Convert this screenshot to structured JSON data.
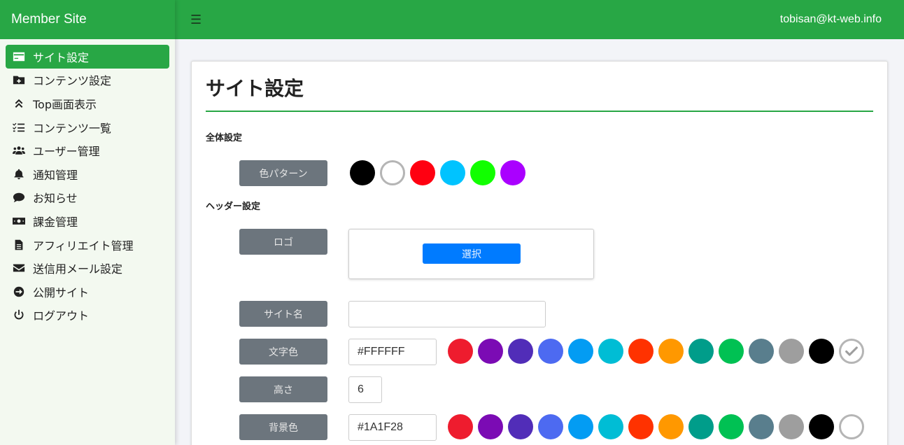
{
  "sidebar": {
    "brand": "Member Site",
    "items": [
      {
        "label": "サイト設定",
        "icon": "credit-card-icon",
        "active": true
      },
      {
        "label": "コンテンツ設定",
        "icon": "folder-plus-icon"
      },
      {
        "label": "Top画面表示",
        "icon": "angle-double-up-icon"
      },
      {
        "label": "コンテンツ一覧",
        "icon": "tasks-icon"
      },
      {
        "label": "ユーザー管理",
        "icon": "users-icon"
      },
      {
        "label": "通知管理",
        "icon": "bell-icon"
      },
      {
        "label": "お知らせ",
        "icon": "comment-icon"
      },
      {
        "label": "課金管理",
        "icon": "money-bill-icon"
      },
      {
        "label": "アフィリエイト管理",
        "icon": "file-alt-icon"
      },
      {
        "label": "送信用メール設定",
        "icon": "envelope-icon"
      },
      {
        "label": "公開サイト",
        "icon": "arrow-circle-right-icon"
      },
      {
        "label": "ログアウト",
        "icon": "power-off-icon"
      }
    ]
  },
  "header": {
    "menu_icon": "☰",
    "user_email": "tobisan@kt-web.info"
  },
  "main": {
    "title": "サイト設定",
    "overall": {
      "heading": "全体設定",
      "color_pattern_label": "色パターン",
      "palette": [
        "#000000",
        "#ffffff",
        "#ff0011",
        "#00c3ff",
        "#11ff00",
        "#aa00ff"
      ]
    },
    "header_settings": {
      "heading": "ヘッダー設定",
      "logo_label": "ロゴ",
      "select_label": "選択",
      "site_name_label": "サイト名",
      "site_name_value": "",
      "text_color_label": "文字色",
      "text_color_value": "#FFFFFF",
      "height_label": "高さ",
      "height_value": "6",
      "bg_color_label": "背景色",
      "bg_color_value": "#1A1F28",
      "colors": [
        "#ee1c2e",
        "#7b0bb4",
        "#512db8",
        "#4d6af1",
        "#039cf3",
        "#00bdd5",
        "#ff3200",
        "#ff9800",
        "#009d8a",
        "#00c153",
        "#597e8d",
        "#9e9e9e",
        "#000000",
        "#ffffff"
      ]
    }
  },
  "theme": {
    "accent": "#28a745",
    "label_bg": "#6c757d",
    "primary": "#007bff"
  }
}
